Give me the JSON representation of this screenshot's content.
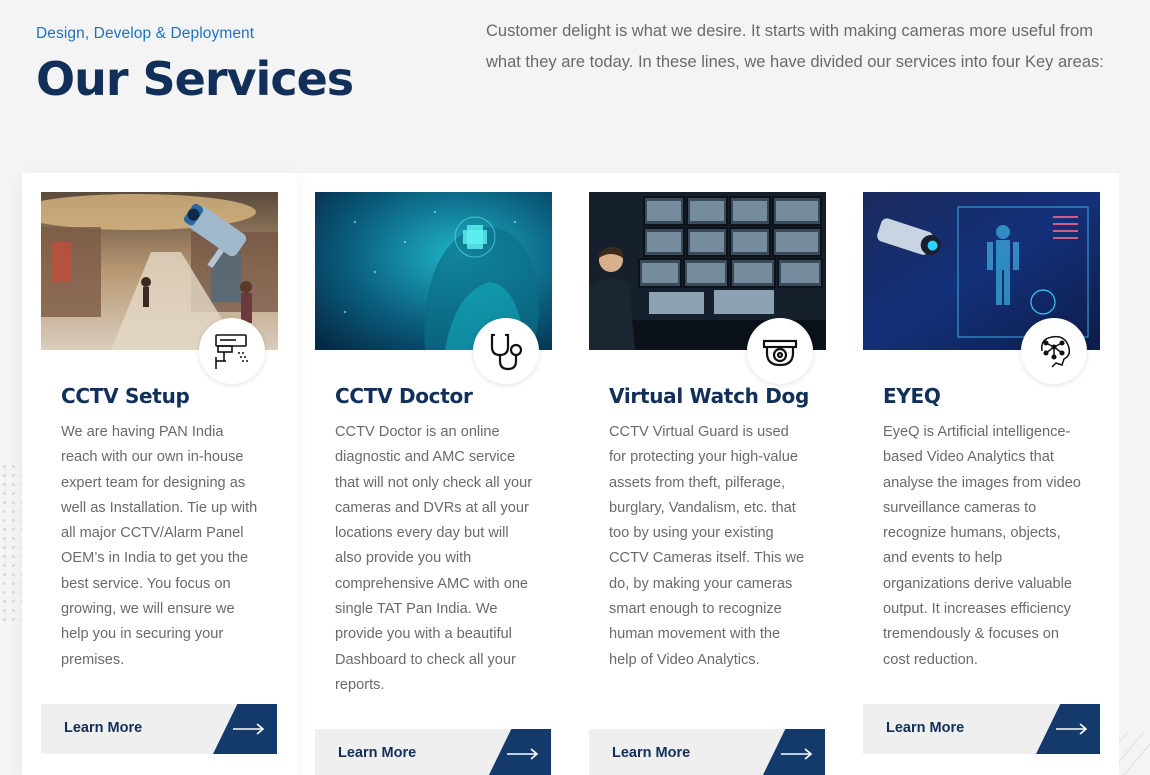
{
  "header": {
    "eyebrow": "Design, Develop & Deployment",
    "title": "Our Services",
    "intro": "Customer delight is what we desire. It starts with making cameras more useful from what they are today. In these lines, we have divided our services into four Key areas:"
  },
  "colors": {
    "navy": "#112f58",
    "accent_blue": "#1e72c0",
    "button_dark": "#133a6a",
    "text_gray": "#6a6a6a"
  },
  "cards": [
    {
      "icon": "cctv-camera-icon",
      "image": "shopping-mall-cctv-photo",
      "title": "CCTV Setup",
      "text": "We are having PAN India reach with our own in-house expert team for designing as well as Installation. Tie up with all major CCTV/Alarm Panel OEM’s in India to get you the best service. You focus on growing, we will ensure we help you in securing your premises.",
      "button": "Learn More"
    },
    {
      "icon": "stethoscope-icon",
      "image": "digital-doctor-photo",
      "title": "CCTV Doctor",
      "text": "CCTV Doctor is an online diagnostic and AMC service that will not only check all your cameras and DVRs at all your locations every day but will also provide you with comprehensive AMC with one single TAT Pan India. We provide you with a beautiful Dashboard to check all your reports.",
      "button": "Learn More"
    },
    {
      "icon": "dome-camera-icon",
      "image": "control-room-photo",
      "title": "Virtual Watch Dog",
      "text": "CCTV Virtual Guard is used for protecting your high-value assets from theft, pilferage, burglary, Vandalism, etc. that too by using your existing CCTV Cameras itself. This we do, by making your cameras smart enough to recognize human movement with the help of Video Analytics.",
      "button": "Learn More"
    },
    {
      "icon": "ai-brain-icon",
      "image": "ai-body-scan-photo",
      "title": "EYEQ",
      "text": "EyeQ is Artificial intelligence-based Video Analytics that analyse the images from video surveillance cameras to recognize humans, objects, and events to help organizations derive valuable output. It increases efficiency tremendously & focuses on cost reduction.",
      "button": "Learn More"
    }
  ]
}
